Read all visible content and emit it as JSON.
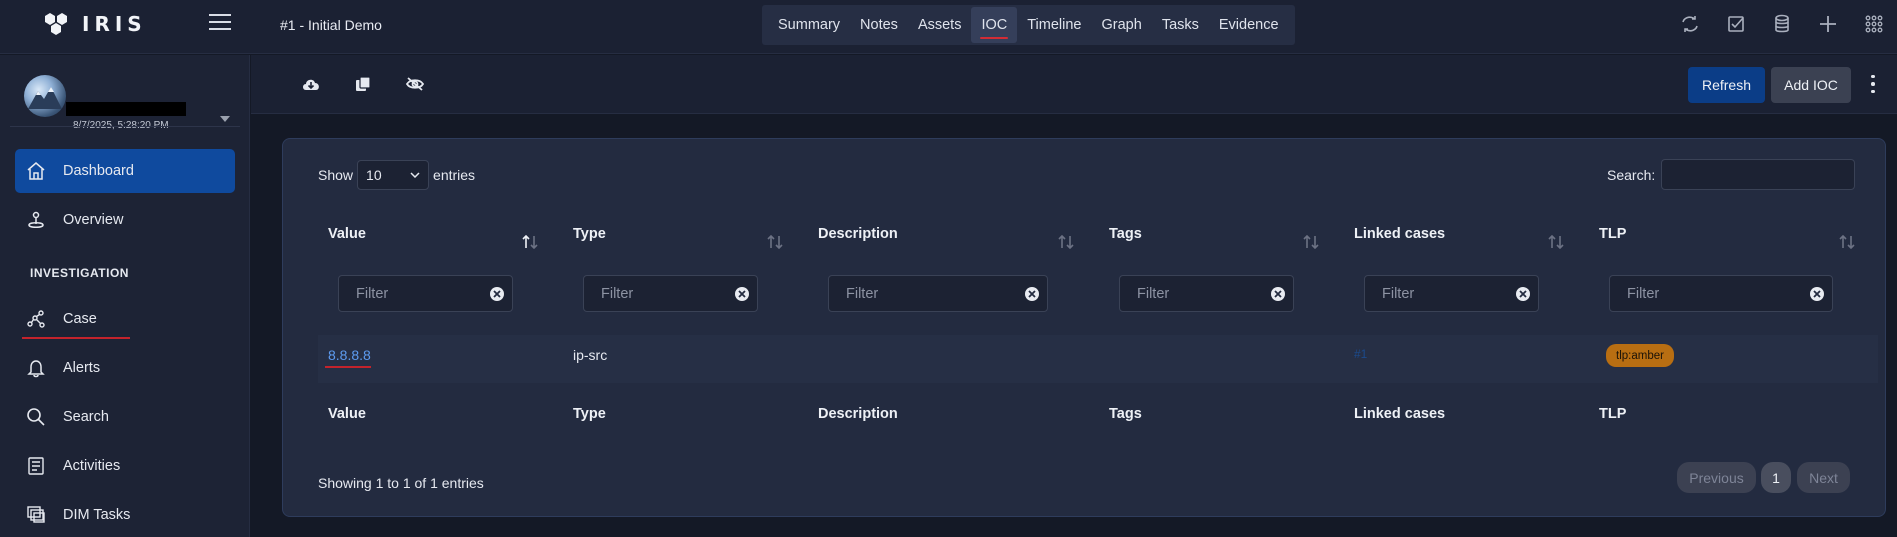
{
  "app": {
    "logo_text": "IRIS",
    "case_title": "#1 - Initial Demo"
  },
  "tabs": [
    {
      "label": "Summary"
    },
    {
      "label": "Notes"
    },
    {
      "label": "Assets"
    },
    {
      "label": "IOC"
    },
    {
      "label": "Timeline"
    },
    {
      "label": "Graph"
    },
    {
      "label": "Tasks"
    },
    {
      "label": "Evidence"
    }
  ],
  "active_tab": "IOC",
  "top_icons": [
    "refresh-icon",
    "checkbox-icon",
    "database-icon",
    "plus-icon",
    "grid-icon"
  ],
  "user": {
    "timestamp": "8/7/2025, 5:28:20 PM"
  },
  "sidebar": {
    "items": [
      {
        "label": "Dashboard",
        "icon": "home-icon"
      },
      {
        "label": "Overview",
        "icon": "overview-icon"
      },
      {
        "label": "Case",
        "icon": "case-graph-icon"
      },
      {
        "label": "Alerts",
        "icon": "bell-icon"
      },
      {
        "label": "Search",
        "icon": "search-icon"
      },
      {
        "label": "Activities",
        "icon": "activities-icon"
      },
      {
        "label": "DIM Tasks",
        "icon": "dim-tasks-icon"
      }
    ],
    "section_label": "INVESTIGATION"
  },
  "toolbar": {
    "icons": [
      "cloud-download-icon",
      "copy-icon",
      "eye-slash-icon"
    ],
    "refresh_label": "Refresh",
    "add_label": "Add IOC"
  },
  "table": {
    "show_label": "Show",
    "entries_label": "entries",
    "page_size": "10",
    "search_label": "Search:",
    "columns": [
      "Value",
      "Type",
      "Description",
      "Tags",
      "Linked cases",
      "TLP"
    ],
    "filter_placeholder": "Filter",
    "rows": [
      {
        "value": "8.8.8.8",
        "type": "ip-src",
        "description": "",
        "tags": "",
        "linked_cases": "#1",
        "tlp": "tlp:amber"
      }
    ],
    "info": "Showing 1 to 1 of 1 entries",
    "pagination": {
      "previous": "Previous",
      "page": "1",
      "next": "Next"
    }
  },
  "colors": {
    "accent": "#0f4a9e",
    "tlp_amber": "#b86e12",
    "active_underline": "#c4232c",
    "link": "#5d9bf0"
  }
}
